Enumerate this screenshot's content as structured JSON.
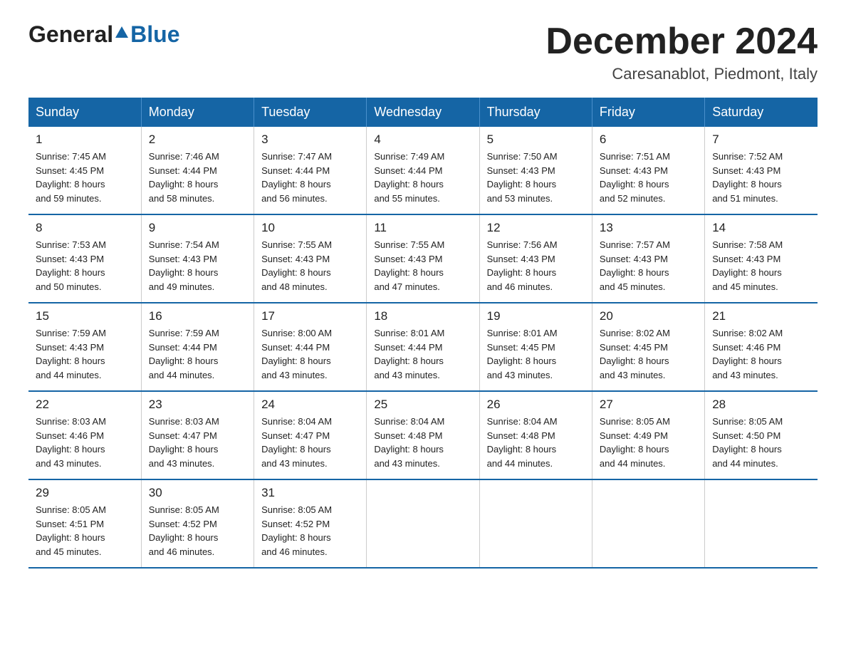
{
  "header": {
    "logo": {
      "general": "General",
      "blue": "Blue"
    },
    "title": "December 2024",
    "location": "Caresanablot, Piedmont, Italy"
  },
  "days_of_week": [
    "Sunday",
    "Monday",
    "Tuesday",
    "Wednesday",
    "Thursday",
    "Friday",
    "Saturday"
  ],
  "weeks": [
    [
      {
        "day": "1",
        "sunrise": "7:45 AM",
        "sunset": "4:45 PM",
        "daylight": "8 hours and 59 minutes."
      },
      {
        "day": "2",
        "sunrise": "7:46 AM",
        "sunset": "4:44 PM",
        "daylight": "8 hours and 58 minutes."
      },
      {
        "day": "3",
        "sunrise": "7:47 AM",
        "sunset": "4:44 PM",
        "daylight": "8 hours and 56 minutes."
      },
      {
        "day": "4",
        "sunrise": "7:49 AM",
        "sunset": "4:44 PM",
        "daylight": "8 hours and 55 minutes."
      },
      {
        "day": "5",
        "sunrise": "7:50 AM",
        "sunset": "4:43 PM",
        "daylight": "8 hours and 53 minutes."
      },
      {
        "day": "6",
        "sunrise": "7:51 AM",
        "sunset": "4:43 PM",
        "daylight": "8 hours and 52 minutes."
      },
      {
        "day": "7",
        "sunrise": "7:52 AM",
        "sunset": "4:43 PM",
        "daylight": "8 hours and 51 minutes."
      }
    ],
    [
      {
        "day": "8",
        "sunrise": "7:53 AM",
        "sunset": "4:43 PM",
        "daylight": "8 hours and 50 minutes."
      },
      {
        "day": "9",
        "sunrise": "7:54 AM",
        "sunset": "4:43 PM",
        "daylight": "8 hours and 49 minutes."
      },
      {
        "day": "10",
        "sunrise": "7:55 AM",
        "sunset": "4:43 PM",
        "daylight": "8 hours and 48 minutes."
      },
      {
        "day": "11",
        "sunrise": "7:55 AM",
        "sunset": "4:43 PM",
        "daylight": "8 hours and 47 minutes."
      },
      {
        "day": "12",
        "sunrise": "7:56 AM",
        "sunset": "4:43 PM",
        "daylight": "8 hours and 46 minutes."
      },
      {
        "day": "13",
        "sunrise": "7:57 AM",
        "sunset": "4:43 PM",
        "daylight": "8 hours and 45 minutes."
      },
      {
        "day": "14",
        "sunrise": "7:58 AM",
        "sunset": "4:43 PM",
        "daylight": "8 hours and 45 minutes."
      }
    ],
    [
      {
        "day": "15",
        "sunrise": "7:59 AM",
        "sunset": "4:43 PM",
        "daylight": "8 hours and 44 minutes."
      },
      {
        "day": "16",
        "sunrise": "7:59 AM",
        "sunset": "4:44 PM",
        "daylight": "8 hours and 44 minutes."
      },
      {
        "day": "17",
        "sunrise": "8:00 AM",
        "sunset": "4:44 PM",
        "daylight": "8 hours and 43 minutes."
      },
      {
        "day": "18",
        "sunrise": "8:01 AM",
        "sunset": "4:44 PM",
        "daylight": "8 hours and 43 minutes."
      },
      {
        "day": "19",
        "sunrise": "8:01 AM",
        "sunset": "4:45 PM",
        "daylight": "8 hours and 43 minutes."
      },
      {
        "day": "20",
        "sunrise": "8:02 AM",
        "sunset": "4:45 PM",
        "daylight": "8 hours and 43 minutes."
      },
      {
        "day": "21",
        "sunrise": "8:02 AM",
        "sunset": "4:46 PM",
        "daylight": "8 hours and 43 minutes."
      }
    ],
    [
      {
        "day": "22",
        "sunrise": "8:03 AM",
        "sunset": "4:46 PM",
        "daylight": "8 hours and 43 minutes."
      },
      {
        "day": "23",
        "sunrise": "8:03 AM",
        "sunset": "4:47 PM",
        "daylight": "8 hours and 43 minutes."
      },
      {
        "day": "24",
        "sunrise": "8:04 AM",
        "sunset": "4:47 PM",
        "daylight": "8 hours and 43 minutes."
      },
      {
        "day": "25",
        "sunrise": "8:04 AM",
        "sunset": "4:48 PM",
        "daylight": "8 hours and 43 minutes."
      },
      {
        "day": "26",
        "sunrise": "8:04 AM",
        "sunset": "4:48 PM",
        "daylight": "8 hours and 44 minutes."
      },
      {
        "day": "27",
        "sunrise": "8:05 AM",
        "sunset": "4:49 PM",
        "daylight": "8 hours and 44 minutes."
      },
      {
        "day": "28",
        "sunrise": "8:05 AM",
        "sunset": "4:50 PM",
        "daylight": "8 hours and 44 minutes."
      }
    ],
    [
      {
        "day": "29",
        "sunrise": "8:05 AM",
        "sunset": "4:51 PM",
        "daylight": "8 hours and 45 minutes."
      },
      {
        "day": "30",
        "sunrise": "8:05 AM",
        "sunset": "4:52 PM",
        "daylight": "8 hours and 46 minutes."
      },
      {
        "day": "31",
        "sunrise": "8:05 AM",
        "sunset": "4:52 PM",
        "daylight": "8 hours and 46 minutes."
      },
      null,
      null,
      null,
      null
    ]
  ]
}
